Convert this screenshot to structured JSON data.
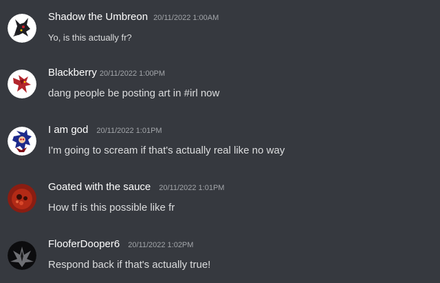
{
  "messages": [
    {
      "username": "Shadow the Umbreon",
      "timestamp": "20/11/2022 1:00AM",
      "text": "Yo, is this actually fr?",
      "avatar_icon": "umbreon-avatar-icon"
    },
    {
      "username": "Blackberry",
      "timestamp": "20/11/2022 1:00PM",
      "text": "dang people be posting art in #irl now",
      "avatar_icon": "red-dragon-avatar-icon"
    },
    {
      "username": "I am god",
      "timestamp": "20/11/2022 1:01PM",
      "text": "I'm going to scream if that's actually real like no way",
      "avatar_icon": "sonic-exe-avatar-icon"
    },
    {
      "username": "Goated with the sauce",
      "timestamp": "20/11/2022 1:01PM",
      "text": "How tf is this possible like fr",
      "avatar_icon": "red-blob-avatar-icon"
    },
    {
      "username": "FlooferDooper6",
      "timestamp": "20/11/2022 1:02PM",
      "text": "Respond back if that's actually true!",
      "avatar_icon": "dark-wings-avatar-icon"
    }
  ],
  "colors": {
    "background": "#36393f",
    "username": "#ffffff",
    "timestamp": "#a3a6aa",
    "message_text": "#dcddde"
  }
}
